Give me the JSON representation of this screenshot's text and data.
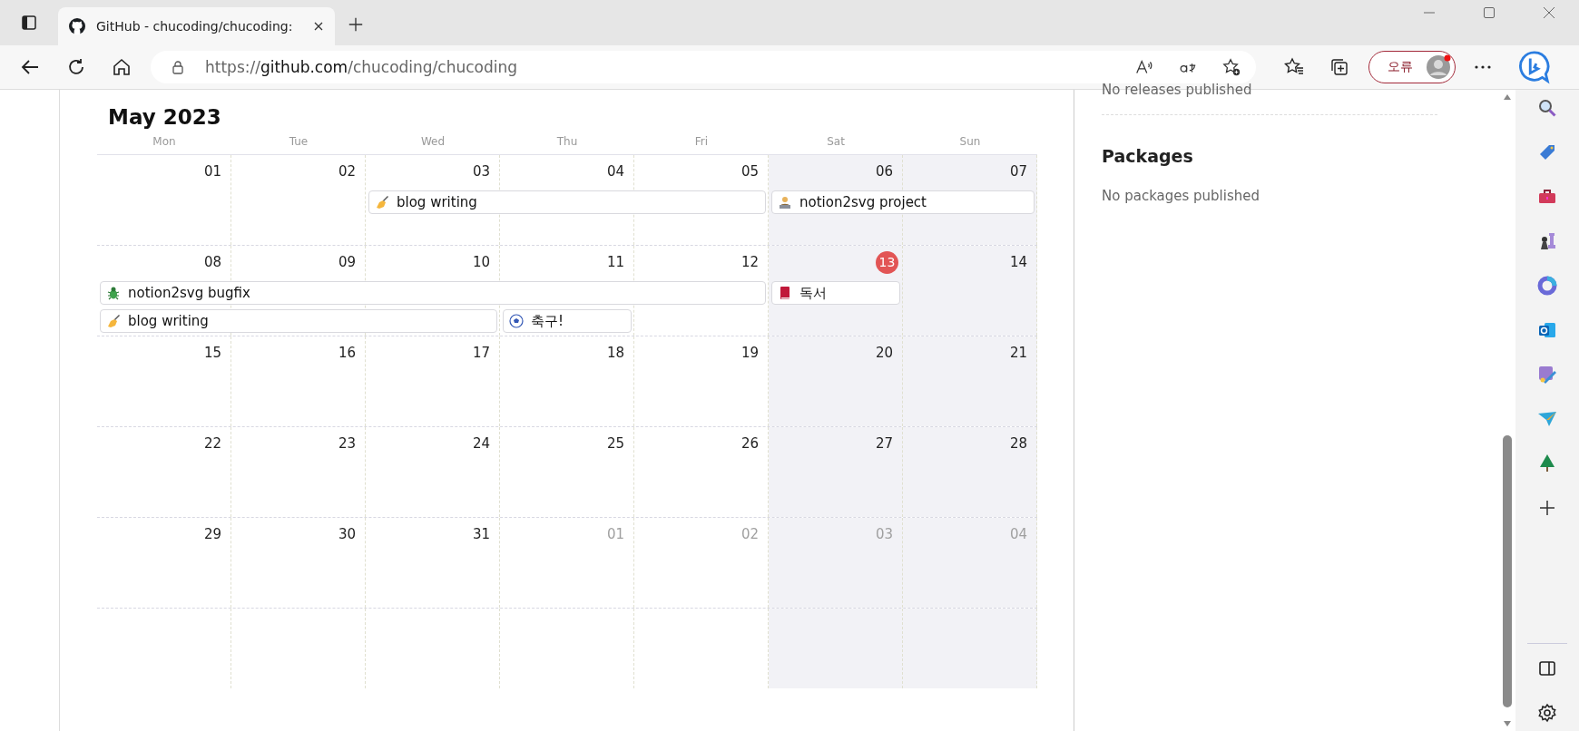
{
  "browser": {
    "tab": {
      "title": "GitHub - chucoding/chucoding:"
    },
    "address": {
      "scheme": "https://",
      "host": "github.com",
      "path": "/chucoding/chucoding"
    },
    "profile": {
      "label": "오류"
    }
  },
  "calendar": {
    "title": "May 2023",
    "weekdays": [
      {
        "label": "Mon",
        "weekend": false
      },
      {
        "label": "Tue",
        "weekend": false
      },
      {
        "label": "Wed",
        "weekend": false
      },
      {
        "label": "Thu",
        "weekend": false
      },
      {
        "label": "Fri",
        "weekend": false
      },
      {
        "label": "Sat",
        "weekend": true
      },
      {
        "label": "Sun",
        "weekend": true
      }
    ],
    "weeks": [
      {
        "days": [
          {
            "label": "01",
            "muted": false,
            "today": false
          },
          {
            "label": "02",
            "muted": false,
            "today": false
          },
          {
            "label": "03",
            "muted": false,
            "today": false
          },
          {
            "label": "04",
            "muted": false,
            "today": false
          },
          {
            "label": "05",
            "muted": false,
            "today": false
          },
          {
            "label": "06",
            "muted": false,
            "today": false
          },
          {
            "label": "07",
            "muted": false,
            "today": false
          }
        ],
        "lanes": [
          [
            {
              "kind": "empty"
            },
            {
              "kind": "empty"
            },
            {
              "kind": "writing",
              "title": "blog writing"
            },
            {
              "kind": "continued"
            },
            {
              "kind": "continued"
            },
            {
              "kind": "desk",
              "title": "notion2svg project"
            },
            {
              "kind": "continued"
            }
          ]
        ]
      },
      {
        "days": [
          {
            "label": "08",
            "muted": false,
            "today": false
          },
          {
            "label": "09",
            "muted": false,
            "today": false
          },
          {
            "label": "10",
            "muted": false,
            "today": false
          },
          {
            "label": "11",
            "muted": false,
            "today": false
          },
          {
            "label": "12",
            "muted": false,
            "today": false
          },
          {
            "label": "13",
            "muted": false,
            "today": true
          },
          {
            "label": "14",
            "muted": false,
            "today": false
          }
        ],
        "lanes": [
          [
            {
              "kind": "bug",
              "title": "notion2svg bugfix"
            },
            {
              "kind": "continued"
            },
            {
              "kind": "continued"
            },
            {
              "kind": "continued"
            },
            {
              "kind": "continued"
            },
            {
              "kind": "book",
              "title": "독서"
            },
            {
              "kind": "empty"
            }
          ],
          [
            {
              "kind": "writing",
              "title": "blog writing"
            },
            {
              "kind": "continued"
            },
            {
              "kind": "continued"
            },
            {
              "kind": "soccer",
              "title": "축구!"
            },
            {
              "kind": "empty"
            },
            {
              "kind": "empty"
            },
            {
              "kind": "empty"
            }
          ]
        ]
      },
      {
        "days": [
          {
            "label": "15",
            "muted": false,
            "today": false
          },
          {
            "label": "16",
            "muted": false,
            "today": false
          },
          {
            "label": "17",
            "muted": false,
            "today": false
          },
          {
            "label": "18",
            "muted": false,
            "today": false
          },
          {
            "label": "19",
            "muted": false,
            "today": false
          },
          {
            "label": "20",
            "muted": false,
            "today": false
          },
          {
            "label": "21",
            "muted": false,
            "today": false
          }
        ]
      },
      {
        "days": [
          {
            "label": "22",
            "muted": false,
            "today": false
          },
          {
            "label": "23",
            "muted": false,
            "today": false
          },
          {
            "label": "24",
            "muted": false,
            "today": false
          },
          {
            "label": "25",
            "muted": false,
            "today": false
          },
          {
            "label": "26",
            "muted": false,
            "today": false
          },
          {
            "label": "27",
            "muted": false,
            "today": false
          },
          {
            "label": "28",
            "muted": false,
            "today": false
          }
        ]
      },
      {
        "days": [
          {
            "label": "29",
            "muted": false,
            "today": false
          },
          {
            "label": "30",
            "muted": false,
            "today": false
          },
          {
            "label": "31",
            "muted": false,
            "today": false
          },
          {
            "label": "01",
            "muted": true,
            "today": false
          },
          {
            "label": "02",
            "muted": true,
            "today": false
          },
          {
            "label": "03",
            "muted": true,
            "today": false
          },
          {
            "label": "04",
            "muted": true,
            "today": false
          }
        ]
      }
    ]
  },
  "side_panel": {
    "releases_text": "No releases published",
    "packages_title": "Packages",
    "packages_text": "No packages published"
  }
}
